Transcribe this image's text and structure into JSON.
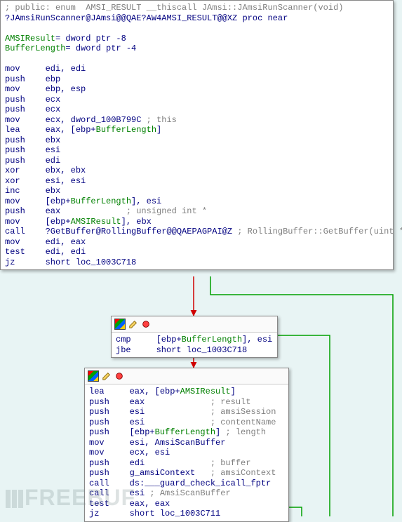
{
  "node1": {
    "lines": [
      {
        "segs": [
          {
            "t": "; public: enum  AMSI_RESULT __thiscall JAmsi::JAmsiRunScanner(void)",
            "c": "cm"
          }
        ]
      },
      {
        "segs": [
          {
            "t": "?JAmsiRunScanner@JAmsi@@QAE?AW4AMSI_RESULT@@XZ ",
            "c": "kw"
          },
          {
            "t": "proc near",
            "c": "kw"
          }
        ]
      },
      {
        "segs": [
          {
            "t": " "
          }
        ]
      },
      {
        "segs": [
          {
            "t": "AMSIResult",
            "c": "op"
          },
          {
            "t": "= dword ptr -8",
            "c": "kw"
          }
        ]
      },
      {
        "segs": [
          {
            "t": "BufferLength",
            "c": "op"
          },
          {
            "t": "= dword ptr -4",
            "c": "kw"
          }
        ]
      },
      {
        "segs": [
          {
            "t": " "
          }
        ]
      },
      {
        "segs": [
          {
            "t": "mov     ",
            "c": "kw"
          },
          {
            "t": "edi, edi",
            "c": "kw"
          }
        ]
      },
      {
        "segs": [
          {
            "t": "push    ",
            "c": "kw"
          },
          {
            "t": "ebp",
            "c": "kw"
          }
        ]
      },
      {
        "segs": [
          {
            "t": "mov     ",
            "c": "kw"
          },
          {
            "t": "ebp, esp",
            "c": "kw"
          }
        ]
      },
      {
        "segs": [
          {
            "t": "push    ",
            "c": "kw"
          },
          {
            "t": "ecx",
            "c": "kw"
          }
        ]
      },
      {
        "segs": [
          {
            "t": "push    ",
            "c": "kw"
          },
          {
            "t": "ecx",
            "c": "kw"
          }
        ]
      },
      {
        "segs": [
          {
            "t": "mov     ",
            "c": "kw"
          },
          {
            "t": "ecx, ",
            "c": "kw"
          },
          {
            "t": "dword_100B799C",
            "c": "kw"
          },
          {
            "t": " ; this",
            "c": "cm"
          }
        ]
      },
      {
        "segs": [
          {
            "t": "lea     ",
            "c": "kw"
          },
          {
            "t": "eax, [ebp+",
            "c": "kw"
          },
          {
            "t": "BufferLength",
            "c": "op"
          },
          {
            "t": "]",
            "c": "kw"
          }
        ]
      },
      {
        "segs": [
          {
            "t": "push    ",
            "c": "kw"
          },
          {
            "t": "ebx",
            "c": "kw"
          }
        ]
      },
      {
        "segs": [
          {
            "t": "push    ",
            "c": "kw"
          },
          {
            "t": "esi",
            "c": "kw"
          }
        ]
      },
      {
        "segs": [
          {
            "t": "push    ",
            "c": "kw"
          },
          {
            "t": "edi",
            "c": "kw"
          }
        ]
      },
      {
        "segs": [
          {
            "t": "xor     ",
            "c": "kw"
          },
          {
            "t": "ebx, ebx",
            "c": "kw"
          }
        ]
      },
      {
        "segs": [
          {
            "t": "xor     ",
            "c": "kw"
          },
          {
            "t": "esi, esi",
            "c": "kw"
          }
        ]
      },
      {
        "segs": [
          {
            "t": "inc     ",
            "c": "kw"
          },
          {
            "t": "ebx",
            "c": "kw"
          }
        ]
      },
      {
        "segs": [
          {
            "t": "mov     ",
            "c": "kw"
          },
          {
            "t": "[ebp+",
            "c": "kw"
          },
          {
            "t": "BufferLength",
            "c": "op"
          },
          {
            "t": "], esi",
            "c": "kw"
          }
        ]
      },
      {
        "segs": [
          {
            "t": "push    ",
            "c": "kw"
          },
          {
            "t": "eax             ",
            "c": "kw"
          },
          {
            "t": "; unsigned int *",
            "c": "cm"
          }
        ]
      },
      {
        "segs": [
          {
            "t": "mov     ",
            "c": "kw"
          },
          {
            "t": "[ebp+",
            "c": "kw"
          },
          {
            "t": "AMSIResult",
            "c": "op"
          },
          {
            "t": "], ebx",
            "c": "kw"
          }
        ]
      },
      {
        "segs": [
          {
            "t": "call    ",
            "c": "kw"
          },
          {
            "t": "?GetBuffer@RollingBuffer@@QAEPAGPAI@Z",
            "c": "kw"
          },
          {
            "t": " ; RollingBuffer::GetBuffer(uint *)",
            "c": "cm"
          }
        ]
      },
      {
        "segs": [
          {
            "t": "mov     ",
            "c": "kw"
          },
          {
            "t": "edi, eax",
            "c": "kw"
          }
        ]
      },
      {
        "segs": [
          {
            "t": "test    ",
            "c": "kw"
          },
          {
            "t": "edi, edi",
            "c": "kw"
          }
        ]
      },
      {
        "segs": [
          {
            "t": "jz      ",
            "c": "kw"
          },
          {
            "t": "short ",
            "c": "kw"
          },
          {
            "t": "loc_1003C718",
            "c": "kw"
          }
        ]
      }
    ]
  },
  "node2": {
    "lines": [
      {
        "segs": [
          {
            "t": "cmp     ",
            "c": "kw"
          },
          {
            "t": "[ebp+",
            "c": "kw"
          },
          {
            "t": "BufferLength",
            "c": "op"
          },
          {
            "t": "], esi",
            "c": "kw"
          }
        ]
      },
      {
        "segs": [
          {
            "t": "jbe     ",
            "c": "kw"
          },
          {
            "t": "short ",
            "c": "kw"
          },
          {
            "t": "loc_1003C718",
            "c": "kw"
          }
        ]
      }
    ]
  },
  "node3": {
    "lines": [
      {
        "segs": [
          {
            "t": "lea     ",
            "c": "kw"
          },
          {
            "t": "eax, [ebp+",
            "c": "kw"
          },
          {
            "t": "AMSIResult",
            "c": "op"
          },
          {
            "t": "]",
            "c": "kw"
          }
        ]
      },
      {
        "segs": [
          {
            "t": "push    ",
            "c": "kw"
          },
          {
            "t": "eax             ",
            "c": "kw"
          },
          {
            "t": "; result",
            "c": "cm"
          }
        ]
      },
      {
        "segs": [
          {
            "t": "push    ",
            "c": "kw"
          },
          {
            "t": "esi             ",
            "c": "kw"
          },
          {
            "t": "; amsiSession",
            "c": "cm"
          }
        ]
      },
      {
        "segs": [
          {
            "t": "push    ",
            "c": "kw"
          },
          {
            "t": "esi             ",
            "c": "kw"
          },
          {
            "t": "; contentName",
            "c": "cm"
          }
        ]
      },
      {
        "segs": [
          {
            "t": "push    ",
            "c": "kw"
          },
          {
            "t": "[ebp+",
            "c": "kw"
          },
          {
            "t": "BufferLength",
            "c": "op"
          },
          {
            "t": "] ",
            "c": "kw"
          },
          {
            "t": "; length",
            "c": "cm"
          }
        ]
      },
      {
        "segs": [
          {
            "t": "mov     ",
            "c": "kw"
          },
          {
            "t": "esi, ",
            "c": "kw"
          },
          {
            "t": "AmsiScanBuffer",
            "c": "kw"
          }
        ]
      },
      {
        "segs": [
          {
            "t": "mov     ",
            "c": "kw"
          },
          {
            "t": "ecx, esi",
            "c": "kw"
          }
        ]
      },
      {
        "segs": [
          {
            "t": "push    ",
            "c": "kw"
          },
          {
            "t": "edi             ",
            "c": "kw"
          },
          {
            "t": "; buffer",
            "c": "cm"
          }
        ]
      },
      {
        "segs": [
          {
            "t": "push    ",
            "c": "kw"
          },
          {
            "t": "g_amsiContext   ",
            "c": "kw"
          },
          {
            "t": "; amsiContext",
            "c": "cm"
          }
        ]
      },
      {
        "segs": [
          {
            "t": "call    ",
            "c": "kw"
          },
          {
            "t": "ds:___guard_check_icall_fptr",
            "c": "kw"
          }
        ]
      },
      {
        "segs": [
          {
            "t": "call    ",
            "c": "kw"
          },
          {
            "t": "esi ",
            "c": "kw"
          },
          {
            "t": "; AmsiScanBuffer",
            "c": "cm"
          }
        ]
      },
      {
        "segs": [
          {
            "t": "test    ",
            "c": "kw"
          },
          {
            "t": "eax, eax",
            "c": "kw"
          }
        ]
      },
      {
        "segs": [
          {
            "t": "jz      ",
            "c": "kw"
          },
          {
            "t": "short ",
            "c": "kw"
          },
          {
            "t": "loc_1003C711",
            "c": "kw"
          }
        ]
      }
    ]
  },
  "watermark": "FREEBUF"
}
